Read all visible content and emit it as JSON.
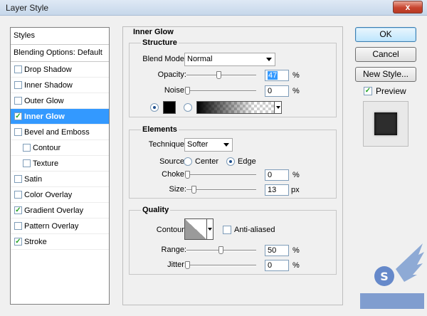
{
  "window": {
    "title": "Layer Style",
    "close_label": "x"
  },
  "styles_panel": {
    "header": "Styles",
    "blending": "Blending Options: Default",
    "items": [
      {
        "label": "Drop Shadow",
        "checked": false,
        "sub": false,
        "selected": false
      },
      {
        "label": "Inner Shadow",
        "checked": false,
        "sub": false,
        "selected": false
      },
      {
        "label": "Outer Glow",
        "checked": false,
        "sub": false,
        "selected": false
      },
      {
        "label": "Inner Glow",
        "checked": true,
        "sub": false,
        "selected": true
      },
      {
        "label": "Bevel and Emboss",
        "checked": false,
        "sub": false,
        "selected": false
      },
      {
        "label": "Contour",
        "checked": false,
        "sub": true,
        "selected": false
      },
      {
        "label": "Texture",
        "checked": false,
        "sub": true,
        "selected": false
      },
      {
        "label": "Satin",
        "checked": false,
        "sub": false,
        "selected": false
      },
      {
        "label": "Color Overlay",
        "checked": false,
        "sub": false,
        "selected": false
      },
      {
        "label": "Gradient Overlay",
        "checked": true,
        "sub": false,
        "selected": false
      },
      {
        "label": "Pattern Overlay",
        "checked": false,
        "sub": false,
        "selected": false
      },
      {
        "label": "Stroke",
        "checked": true,
        "sub": false,
        "selected": false
      }
    ]
  },
  "inner_glow": {
    "title": "Inner Glow",
    "structure": {
      "title": "Structure",
      "blend_mode_label": "Blend Mode:",
      "blend_mode_value": "Normal",
      "opacity_label": "Opacity:",
      "opacity_value": "47",
      "opacity_unit": "%",
      "noise_label": "Noise:",
      "noise_value": "0",
      "noise_unit": "%",
      "color": "#000000"
    },
    "elements": {
      "title": "Elements",
      "technique_label": "Technique:",
      "technique_value": "Softer",
      "source_label": "Source:",
      "source_center": "Center",
      "source_edge": "Edge",
      "choke_label": "Choke:",
      "choke_value": "0",
      "choke_unit": "%",
      "size_label": "Size:",
      "size_value": "13",
      "size_unit": "px"
    },
    "quality": {
      "title": "Quality",
      "contour_label": "Contour:",
      "antialiased_label": "Anti-aliased",
      "range_label": "Range:",
      "range_value": "50",
      "range_unit": "%",
      "jitter_label": "Jitter:",
      "jitter_value": "0",
      "jitter_unit": "%"
    }
  },
  "buttons": {
    "ok": "OK",
    "cancel": "Cancel",
    "new_style": "New Style...",
    "preview": "Preview"
  },
  "colors": {
    "selection": "#3399ff",
    "glow_color": "#000000"
  }
}
